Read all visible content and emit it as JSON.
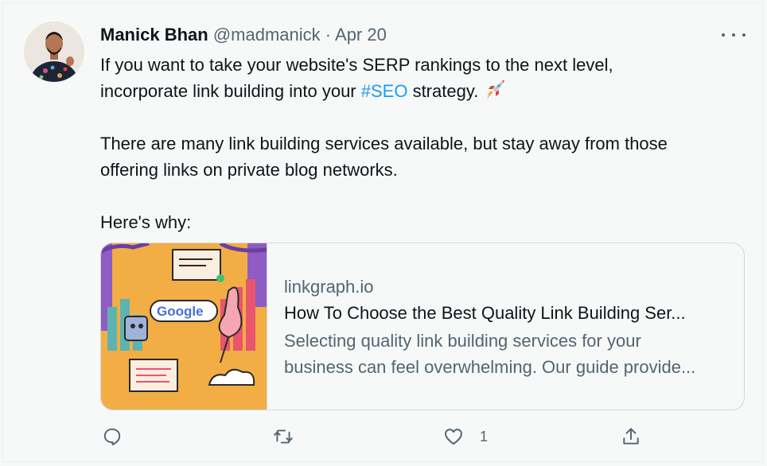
{
  "author": {
    "name": "Manick Bhan",
    "handle": "@madmanick",
    "separator": "·",
    "date": "Apr 20"
  },
  "tweet": {
    "line1": "If you want to take your website's SERP rankings to the next level,",
    "line2_before": "incorporate link building into your ",
    "hashtag": "#SEO",
    "line2_after": " strategy. ",
    "line2_emoji": "rocket",
    "paragraph2_line1": "There are many link building services available, but stay away from those",
    "paragraph2_line2": "offering links on private blog networks.",
    "paragraph3": "Here's why:"
  },
  "link_card": {
    "domain": "linkgraph.io",
    "title": "How To Choose the Best Quality Link Building Ser...",
    "description_line1": "Selecting quality link building services for your",
    "description_line2": "business can feel overwhelming. Our guide provide...",
    "image_text": "Google"
  },
  "actions": {
    "reply_icon": "reply-icon",
    "retweet_icon": "retweet-icon",
    "like_icon": "heart-icon",
    "like_count": "1",
    "share_icon": "share-icon"
  },
  "colors": {
    "link": "#1d9bf0",
    "secondary": "#536471",
    "primary": "#0f1419",
    "background": "#f7f9f9",
    "card_border": "#cfd9de"
  }
}
